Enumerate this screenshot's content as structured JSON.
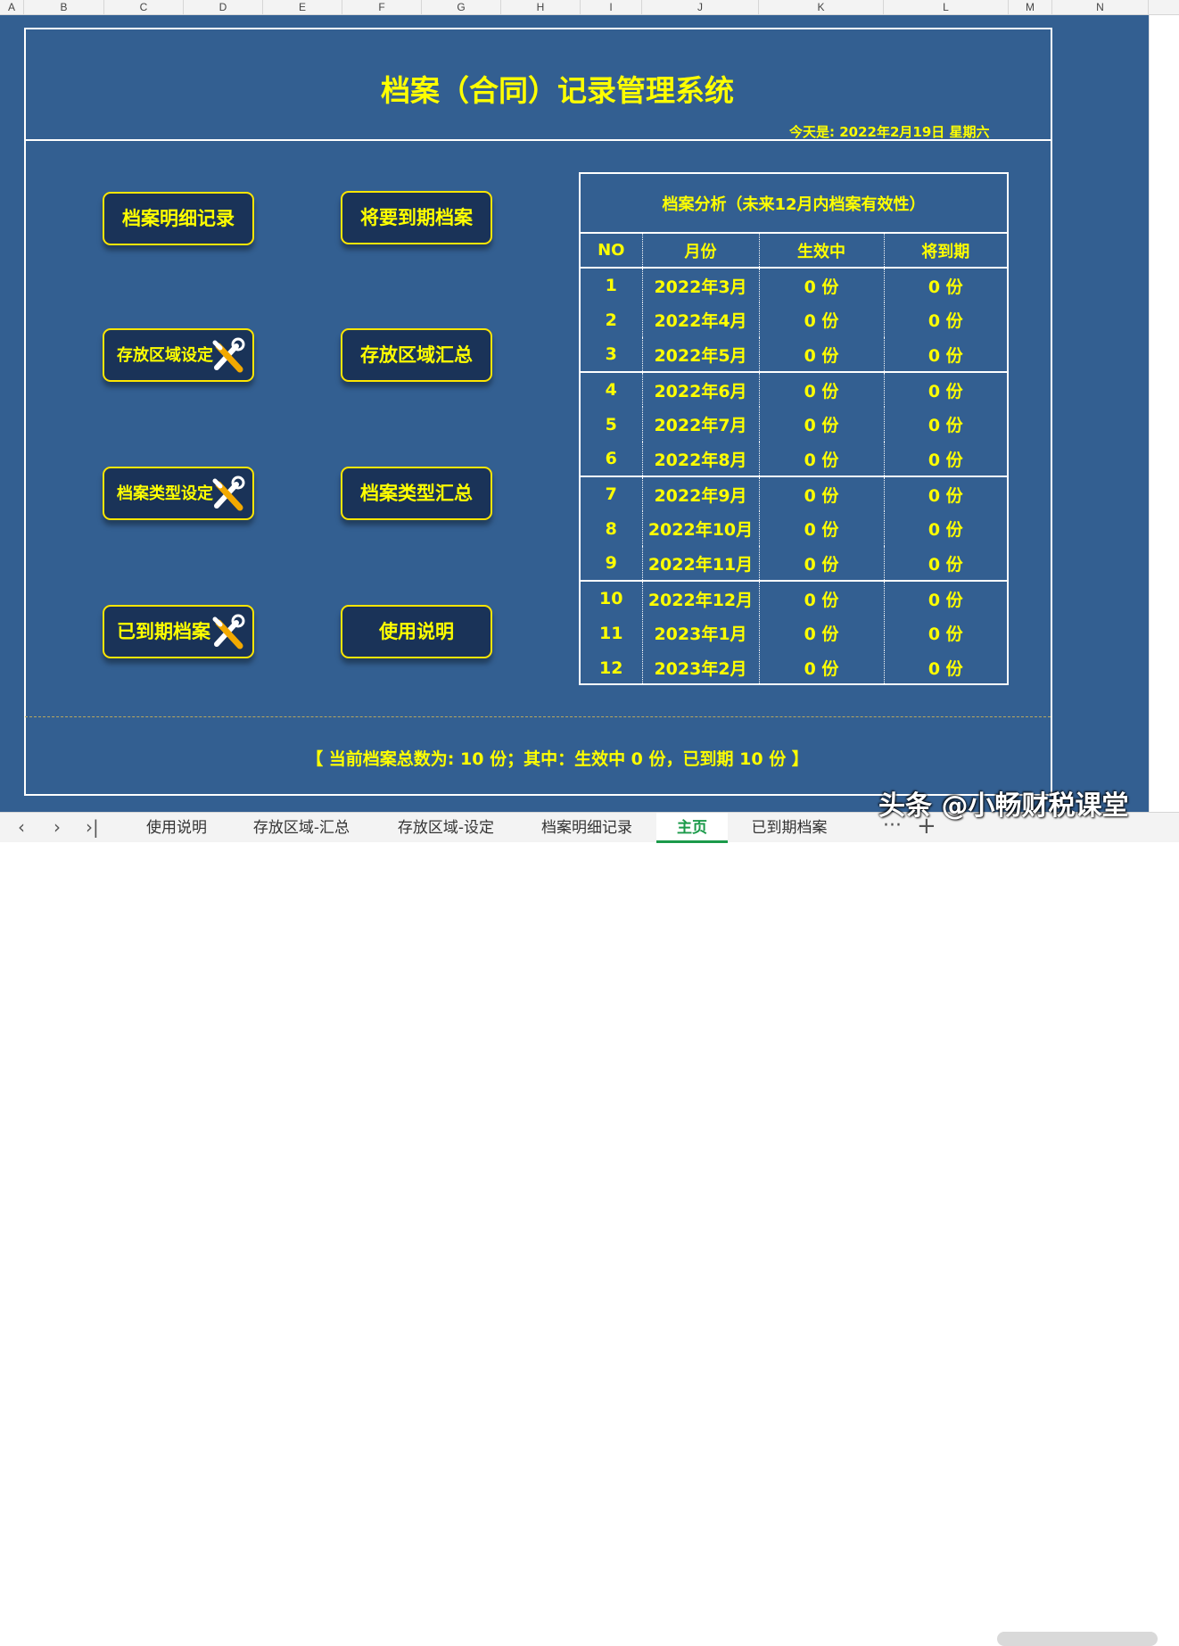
{
  "columns": [
    "A",
    "B",
    "C",
    "D",
    "E",
    "F",
    "G",
    "H",
    "I",
    "J",
    "K",
    "L",
    "M",
    "N"
  ],
  "title": "档案（合同）记录管理系统",
  "date": "今天是: 2022年2月19日 星期六",
  "buttons": {
    "detail": "档案明细记录",
    "expiring": "将要到期档案",
    "area_setting": "存放区域设定",
    "area_summary": "存放区域汇总",
    "type_setting": "档案类型设定",
    "type_summary": "档案类型汇总",
    "expired": "已到期档案",
    "instructions": "使用说明"
  },
  "analysis": {
    "title": "档案分析（未来12月内档案有效性）",
    "headers": [
      "NO",
      "月份",
      "生效中",
      "将到期"
    ],
    "rows": [
      {
        "no": "1",
        "month": "2022年3月",
        "active": "0 份",
        "expiring": "0 份"
      },
      {
        "no": "2",
        "month": "2022年4月",
        "active": "0 份",
        "expiring": "0 份"
      },
      {
        "no": "3",
        "month": "2022年5月",
        "active": "0 份",
        "expiring": "0 份"
      },
      {
        "no": "4",
        "month": "2022年6月",
        "active": "0 份",
        "expiring": "0 份"
      },
      {
        "no": "5",
        "month": "2022年7月",
        "active": "0 份",
        "expiring": "0 份"
      },
      {
        "no": "6",
        "month": "2022年8月",
        "active": "0 份",
        "expiring": "0 份"
      },
      {
        "no": "7",
        "month": "2022年9月",
        "active": "0 份",
        "expiring": "0 份"
      },
      {
        "no": "8",
        "month": "2022年10月",
        "active": "0 份",
        "expiring": "0 份"
      },
      {
        "no": "9",
        "month": "2022年11月",
        "active": "0 份",
        "expiring": "0 份"
      },
      {
        "no": "10",
        "month": "2022年12月",
        "active": "0 份",
        "expiring": "0 份"
      },
      {
        "no": "11",
        "month": "2023年1月",
        "active": "0 份",
        "expiring": "0 份"
      },
      {
        "no": "12",
        "month": "2023年2月",
        "active": "0 份",
        "expiring": "0 份"
      }
    ]
  },
  "summary": "【  当前档案总数为: 10 份；其中：生效中 0 份，已到期 10 份  】",
  "tabs": [
    "使用说明",
    "存放区域-汇总",
    "存放区域-设定",
    "档案明细记录",
    "主页",
    "已到期档案"
  ],
  "active_tab": "主页",
  "more": "···",
  "add": "+",
  "watermark": "头条 @小畅财税课堂",
  "colors": {
    "background": "#335f91",
    "accent": "#ffff00",
    "button": "#1a3358"
  },
  "icons": [
    "tools-icon"
  ]
}
